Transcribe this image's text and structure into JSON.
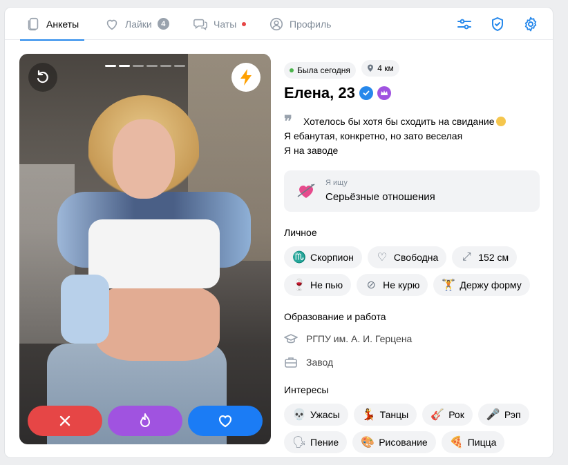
{
  "tabs": [
    {
      "label": "Анкеты",
      "icon": "cards-icon",
      "active": true
    },
    {
      "label": "Лайки",
      "icon": "heart-icon",
      "badge": "4"
    },
    {
      "label": "Чаты",
      "icon": "chats-icon",
      "dot": true
    },
    {
      "label": "Профиль",
      "icon": "profile-icon"
    }
  ],
  "toolbar_icons": [
    "filters-icon",
    "shield-check-icon",
    "gear-icon"
  ],
  "photo": {
    "progress_total": 6,
    "progress_active": 2
  },
  "profile": {
    "status": "Была сегодня",
    "distance": "4 км",
    "name_age": "Елена, 23",
    "bio_lines": [
      "Хотелось бы хотя бы сходить на свидание",
      "Я ебанутая, конкретно, но зато веселая",
      "Я на заводе"
    ],
    "seeking_caption": "Я ищу",
    "seeking_value": "Серьёзные отношения"
  },
  "personal": {
    "title": "Личное",
    "chips": [
      {
        "icon": "♏",
        "label": "Скорпион"
      },
      {
        "icon": "♡",
        "label": "Свободна"
      },
      {
        "icon": "⤢",
        "label": "152 см"
      },
      {
        "icon": "🍷",
        "label": "Не пью"
      },
      {
        "icon": "⊘",
        "label": "Не курю"
      },
      {
        "icon": "🏋",
        "label": "Держу форму"
      }
    ]
  },
  "education": {
    "title": "Образование и работа",
    "university": "РГПУ им. А. И. Герцена",
    "work": "Завод"
  },
  "interests": {
    "title": "Интересы",
    "chips": [
      {
        "icon": "💀",
        "label": "Ужасы"
      },
      {
        "icon": "💃",
        "label": "Танцы"
      },
      {
        "icon": "🎸",
        "label": "Рок"
      },
      {
        "icon": "🎤",
        "label": "Рэп"
      },
      {
        "icon": "🗣",
        "label": "Пение"
      },
      {
        "icon": "🎨",
        "label": "Рисование"
      },
      {
        "icon": "🍕",
        "label": "Пицца"
      }
    ]
  },
  "colors": {
    "accent": "#2688eb",
    "dislike": "#e64646",
    "super": "#a053e0",
    "like": "#1b7cf5"
  }
}
